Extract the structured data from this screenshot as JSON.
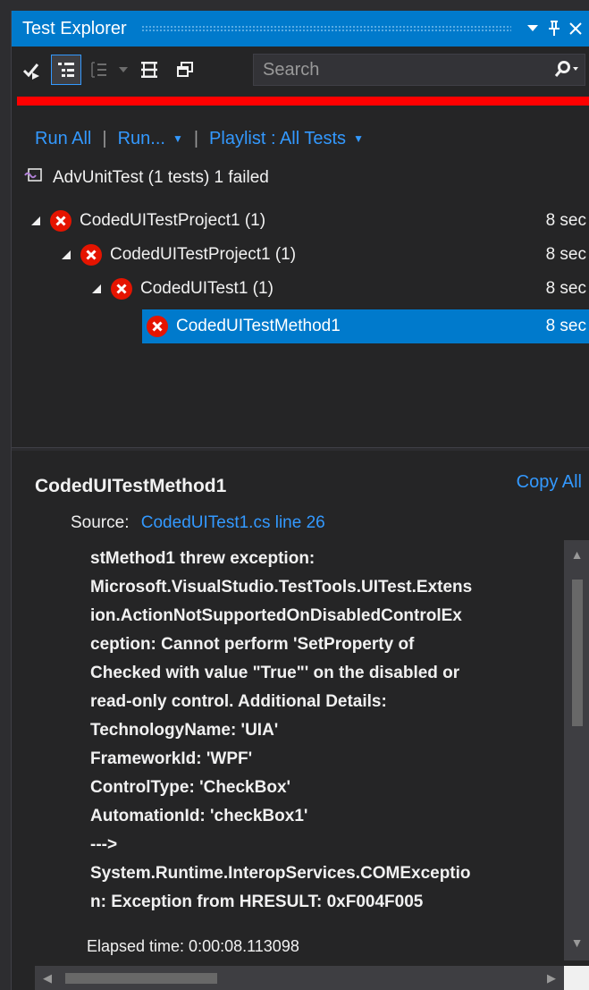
{
  "window": {
    "title": "Test Explorer",
    "title_buttons": [
      "dropdown-icon",
      "pin-icon",
      "close-icon"
    ]
  },
  "toolbar": {
    "tools": [
      "run-tests-after-build-icon",
      "group-by-icon",
      "outline-icon",
      "expand-collapse-icon",
      "options-icon"
    ],
    "search_placeholder": "Search"
  },
  "status": {
    "color": "#ff0000"
  },
  "actions": {
    "run_all": "Run All",
    "run": "Run...",
    "playlist": "Playlist : All Tests"
  },
  "summary": {
    "text": "AdvUnitTest (1 tests) 1 failed"
  },
  "tree": [
    {
      "name": "CodedUITestProject1 (1)",
      "duration": "8 sec",
      "status": "failed"
    },
    {
      "name": "CodedUITestProject1 (1)",
      "duration": "8 sec",
      "status": "failed"
    },
    {
      "name": "CodedUITest1 (1)",
      "duration": "8 sec",
      "status": "failed"
    },
    {
      "name": "CodedUITestMethod1",
      "duration": "8 sec",
      "status": "failed",
      "selected": true
    }
  ],
  "details": {
    "title": "CodedUITestMethod1",
    "copy_all": "Copy All",
    "source_label": "Source:",
    "source_link": "CodedUITest1.cs line 26",
    "message": [
      "stMethod1 threw exception:",
      "Microsoft.VisualStudio.TestTools.UITest.Extens",
      "ion.ActionNotSupportedOnDisabledControlEx",
      "ception: Cannot perform 'SetProperty of",
      "Checked with value \"True\"' on the disabled or",
      "read-only control. Additional Details:",
      "TechnologyName:  'UIA'",
      "FrameworkId:  'WPF'",
      "ControlType:  'CheckBox'",
      "AutomationId:  'checkBox1'",
      " --->",
      "System.Runtime.InteropServices.COMExceptio",
      "n: Exception from HRESULT: 0xF004F005"
    ],
    "elapsed": "Elapsed time: 0:00:08.113098"
  },
  "colors": {
    "accent": "#007acc",
    "link": "#3399ff",
    "fail": "#e51400",
    "background": "#252526"
  }
}
